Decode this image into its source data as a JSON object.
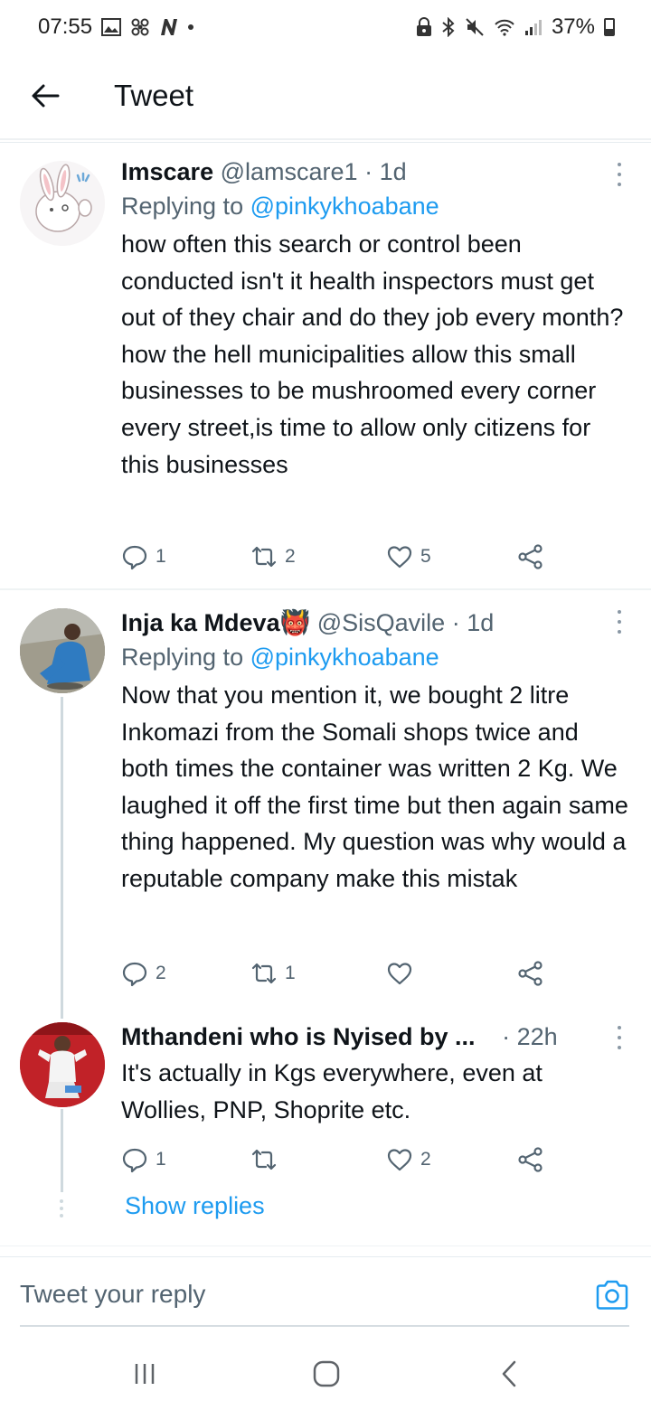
{
  "status_bar": {
    "time": "07:55",
    "battery_percent": "37%",
    "icons_left": [
      "gallery-icon",
      "pinwheel-icon",
      "n-icon",
      "dot-icon"
    ],
    "icons_right": [
      "lock-icon",
      "bluetooth-icon",
      "mute-icon",
      "wifi-icon",
      "signal-icon",
      "battery-icon"
    ]
  },
  "header": {
    "title": "Tweet",
    "back_icon": "back-arrow-icon"
  },
  "tweets": [
    {
      "name": "Imscare",
      "handle": "@lamscare1",
      "time": "· 1d",
      "replying_prefix": "Replying to",
      "replying_to": "@pinkykhoabane",
      "text": "how often this search or control been conducted isn't it health inspectors must get out of they chair and do they job every month?how the hell municipalities allow this small businesses to be mushroomed every corner every street,is time to allow only citizens for this businesses",
      "replies": "1",
      "retweets": "2",
      "likes": "5"
    },
    {
      "name": "Inja ka Mdeva",
      "emoji": "👹",
      "handle": "@SisQavile",
      "time": "· 1d",
      "replying_prefix": "Replying to",
      "replying_to": "@pinkykhoabane",
      "text": "Now that you mention it, we bought 2 litre Inkomazi from the Somali shops twice and both times the container was written 2 Kg. We laughed it off the first time but then again same thing happened. My question was why would a reputable company make this mistak",
      "replies": "2",
      "retweets": "1",
      "likes": ""
    },
    {
      "name": "Mthandeni who is Nyised by ...",
      "handle": "",
      "time": "· 22h",
      "text": "It's actually in Kgs everywhere, even at Wollies, PNP, Shoprite etc.",
      "replies": "1",
      "retweets": "",
      "likes": "2"
    }
  ],
  "show_replies": "Show replies",
  "composer": {
    "placeholder": "Tweet your reply"
  },
  "colors": {
    "accent": "#1d9bf0",
    "text": "#0f1419",
    "secondary": "#536471"
  }
}
